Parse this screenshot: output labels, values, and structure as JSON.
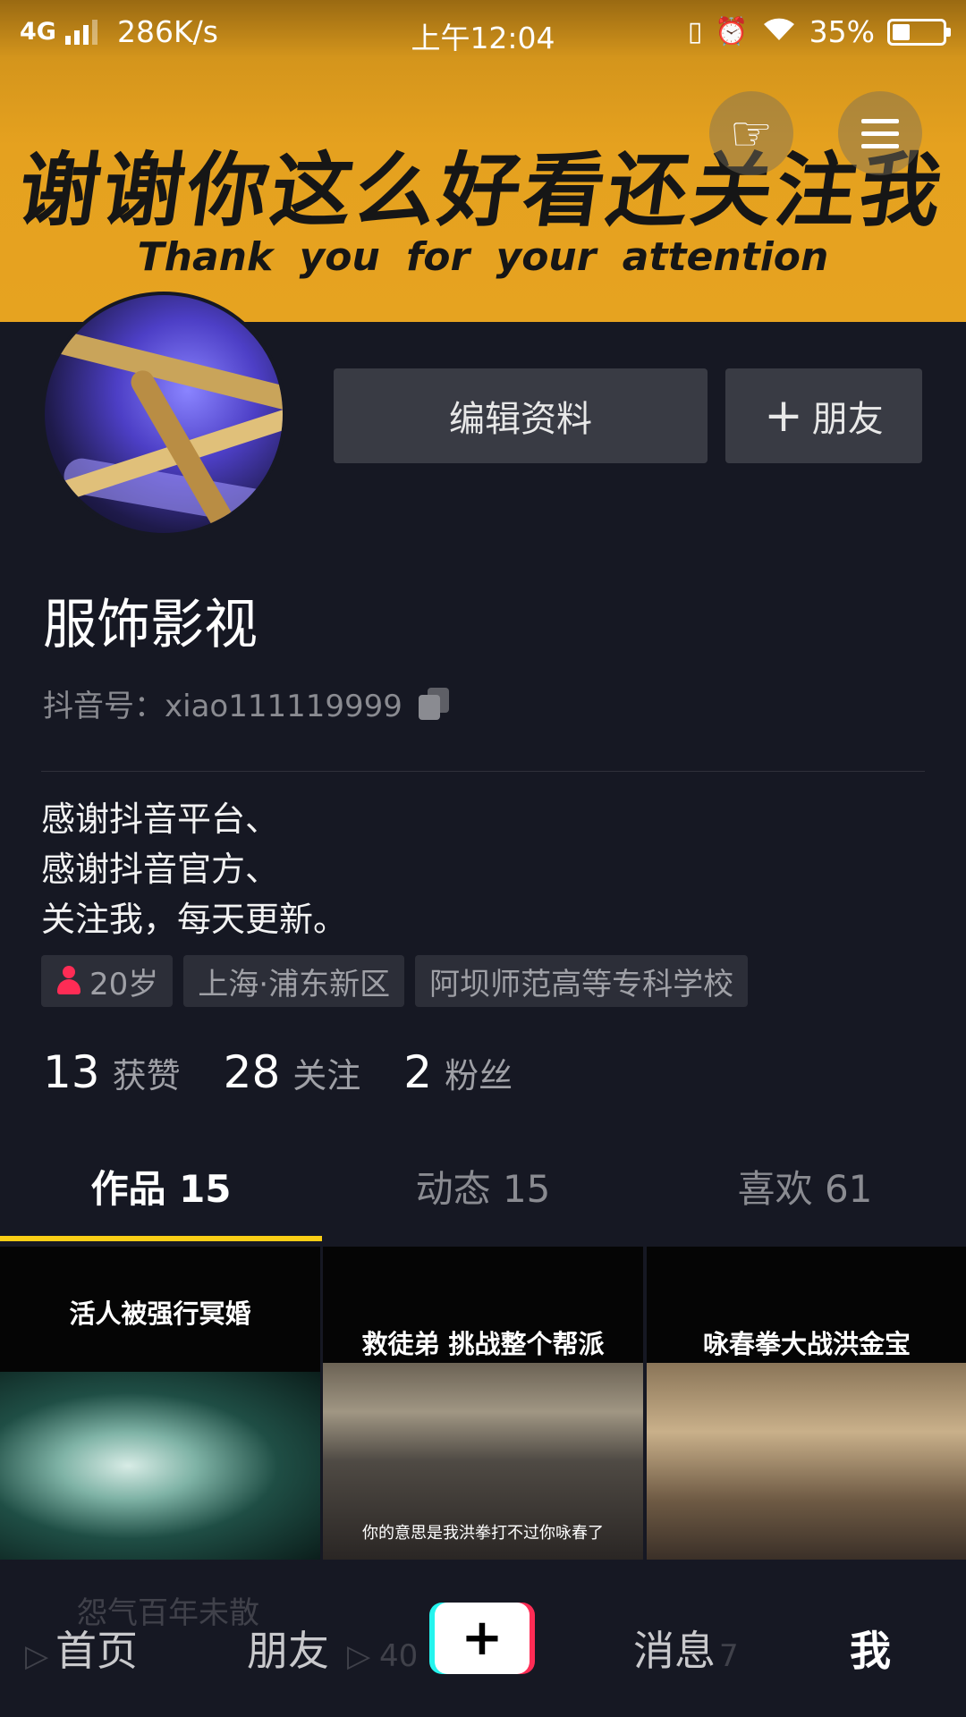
{
  "status_bar": {
    "network": "4G",
    "speed": "286K/s",
    "time": "上午12:04",
    "battery": "35%",
    "battery_level": 0.35
  },
  "banner": {
    "title": "谢谢你这么好看还关注我",
    "subtitle": "Thank you for your attention"
  },
  "header_icons": {
    "hand": "hand-pointing-icon",
    "menu": "menu-icon"
  },
  "actions": {
    "edit_profile": "编辑资料",
    "add_friend": "朋友"
  },
  "profile": {
    "name": "服饰影视",
    "douyin_id": "抖音号：xiao111119999",
    "bio": [
      "感谢抖音平台、",
      "感谢抖音官方、",
      "关注我，每天更新。"
    ],
    "tags": {
      "age": "20岁",
      "location": "上海·浦东新区",
      "school": "阿坝师范高等专科学校"
    }
  },
  "stats": {
    "likes": {
      "num": "13",
      "label": "获赞"
    },
    "following": {
      "num": "28",
      "label": "关注"
    },
    "followers": {
      "num": "2",
      "label": "粉丝"
    }
  },
  "tabs": [
    {
      "label": "作品 15"
    },
    {
      "label": "动态 15"
    },
    {
      "label": "喜欢 61"
    }
  ],
  "videos": [
    {
      "title": "活人被强行冥婚"
    },
    {
      "title": "救徒弟 挑战整个帮派",
      "subtitle": "你的意思是我洪拳打不过你咏春了"
    },
    {
      "title": "咏春拳大战洪金宝"
    }
  ],
  "ghost_text": {
    "row2_title": "怨气百年未散",
    "count_1": "40",
    "count_3": "7"
  },
  "bottom_nav": {
    "home": "首页",
    "friends": "朋友",
    "create": "+",
    "messages": "消息",
    "me": "我"
  },
  "colors": {
    "accent_yellow": "#face15",
    "accent_red": "#fe2c55",
    "accent_cyan": "#25f4ee",
    "background": "#161823"
  }
}
